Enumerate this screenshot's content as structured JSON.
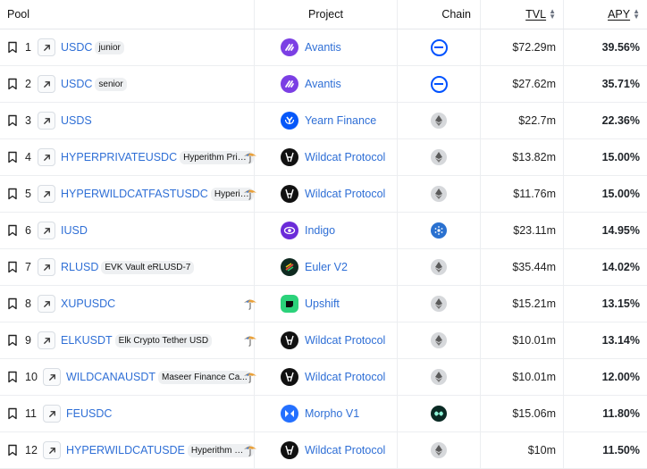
{
  "header": {
    "pool": "Pool",
    "project": "Project",
    "chain": "Chain",
    "tvl": "TVL",
    "apy": "APY"
  },
  "rows": [
    {
      "rank": "1",
      "symbol": "USDC",
      "tag": "junior",
      "project": "Avantis",
      "project_logo": "avantis-logo",
      "chain": "base",
      "tvl": "$72.29m",
      "apy": "39.56%",
      "umbrella": false
    },
    {
      "rank": "2",
      "symbol": "USDC",
      "tag": "senior",
      "project": "Avantis",
      "project_logo": "avantis-logo",
      "chain": "base",
      "tvl": "$27.62m",
      "apy": "35.71%",
      "umbrella": false
    },
    {
      "rank": "3",
      "symbol": "USDS",
      "tag": "",
      "project": "Yearn Finance",
      "project_logo": "yearn-logo",
      "chain": "ethereum",
      "tvl": "$22.7m",
      "apy": "22.36%",
      "umbrella": false
    },
    {
      "rank": "4",
      "symbol": "HYPERPRIVATEUSDC",
      "tag": "Hyperithm Priva...",
      "project": "Wildcat Protocol",
      "project_logo": "wildcat-logo",
      "chain": "ethereum",
      "tvl": "$13.82m",
      "apy": "15.00%",
      "umbrella": true
    },
    {
      "rank": "5",
      "symbol": "HYPERWILDCATFASTUSDC",
      "tag": "Hyperith...",
      "project": "Wildcat Protocol",
      "project_logo": "wildcat-logo",
      "chain": "ethereum",
      "tvl": "$11.76m",
      "apy": "15.00%",
      "umbrella": true
    },
    {
      "rank": "6",
      "symbol": "IUSD",
      "tag": "",
      "project": "Indigo",
      "project_logo": "indigo-logo",
      "chain": "cardano",
      "tvl": "$23.11m",
      "apy": "14.95%",
      "umbrella": false
    },
    {
      "rank": "7",
      "symbol": "RLUSD",
      "tag": "EVK Vault eRLUSD-7",
      "project": "Euler V2",
      "project_logo": "euler-logo",
      "chain": "ethereum",
      "tvl": "$35.44m",
      "apy": "14.02%",
      "umbrella": false
    },
    {
      "rank": "8",
      "symbol": "XUPUSDC",
      "tag": "",
      "project": "Upshift",
      "project_logo": "upshift-logo",
      "chain": "ethereum",
      "tvl": "$15.21m",
      "apy": "13.15%",
      "umbrella": true
    },
    {
      "rank": "9",
      "symbol": "ELKUSDT",
      "tag": "Elk Crypto Tether USD",
      "project": "Wildcat Protocol",
      "project_logo": "wildcat-logo",
      "chain": "ethereum",
      "tvl": "$10.01m",
      "apy": "13.14%",
      "umbrella": true
    },
    {
      "rank": "10",
      "symbol": "WILDCANAUSDT",
      "tag": "Maseer Finance Ca...",
      "project": "Wildcat Protocol",
      "project_logo": "wildcat-logo",
      "chain": "ethereum",
      "tvl": "$10.01m",
      "apy": "12.00%",
      "umbrella": true
    },
    {
      "rank": "11",
      "symbol": "FEUSDC",
      "tag": "",
      "project": "Morpho V1",
      "project_logo": "morpho-logo",
      "chain": "hyperevm",
      "tvl": "$15.06m",
      "apy": "11.80%",
      "umbrella": false
    },
    {
      "rank": "12",
      "symbol": "HYPERWILDCATUSDE",
      "tag": "Hyperithm Wil...",
      "project": "Wildcat Protocol",
      "project_logo": "wildcat-logo",
      "chain": "ethereum",
      "tvl": "$10m",
      "apy": "11.50%",
      "umbrella": true
    }
  ],
  "colors": {
    "link": "#2f6fd6",
    "avantis": "#7b3fe4",
    "yearn": "#0657f9",
    "indigo": "#6b2bd9",
    "upshift": "#2bd27a",
    "morpho": "#2470ff",
    "base": "#0052ff",
    "cardano": "#2a71d0"
  }
}
